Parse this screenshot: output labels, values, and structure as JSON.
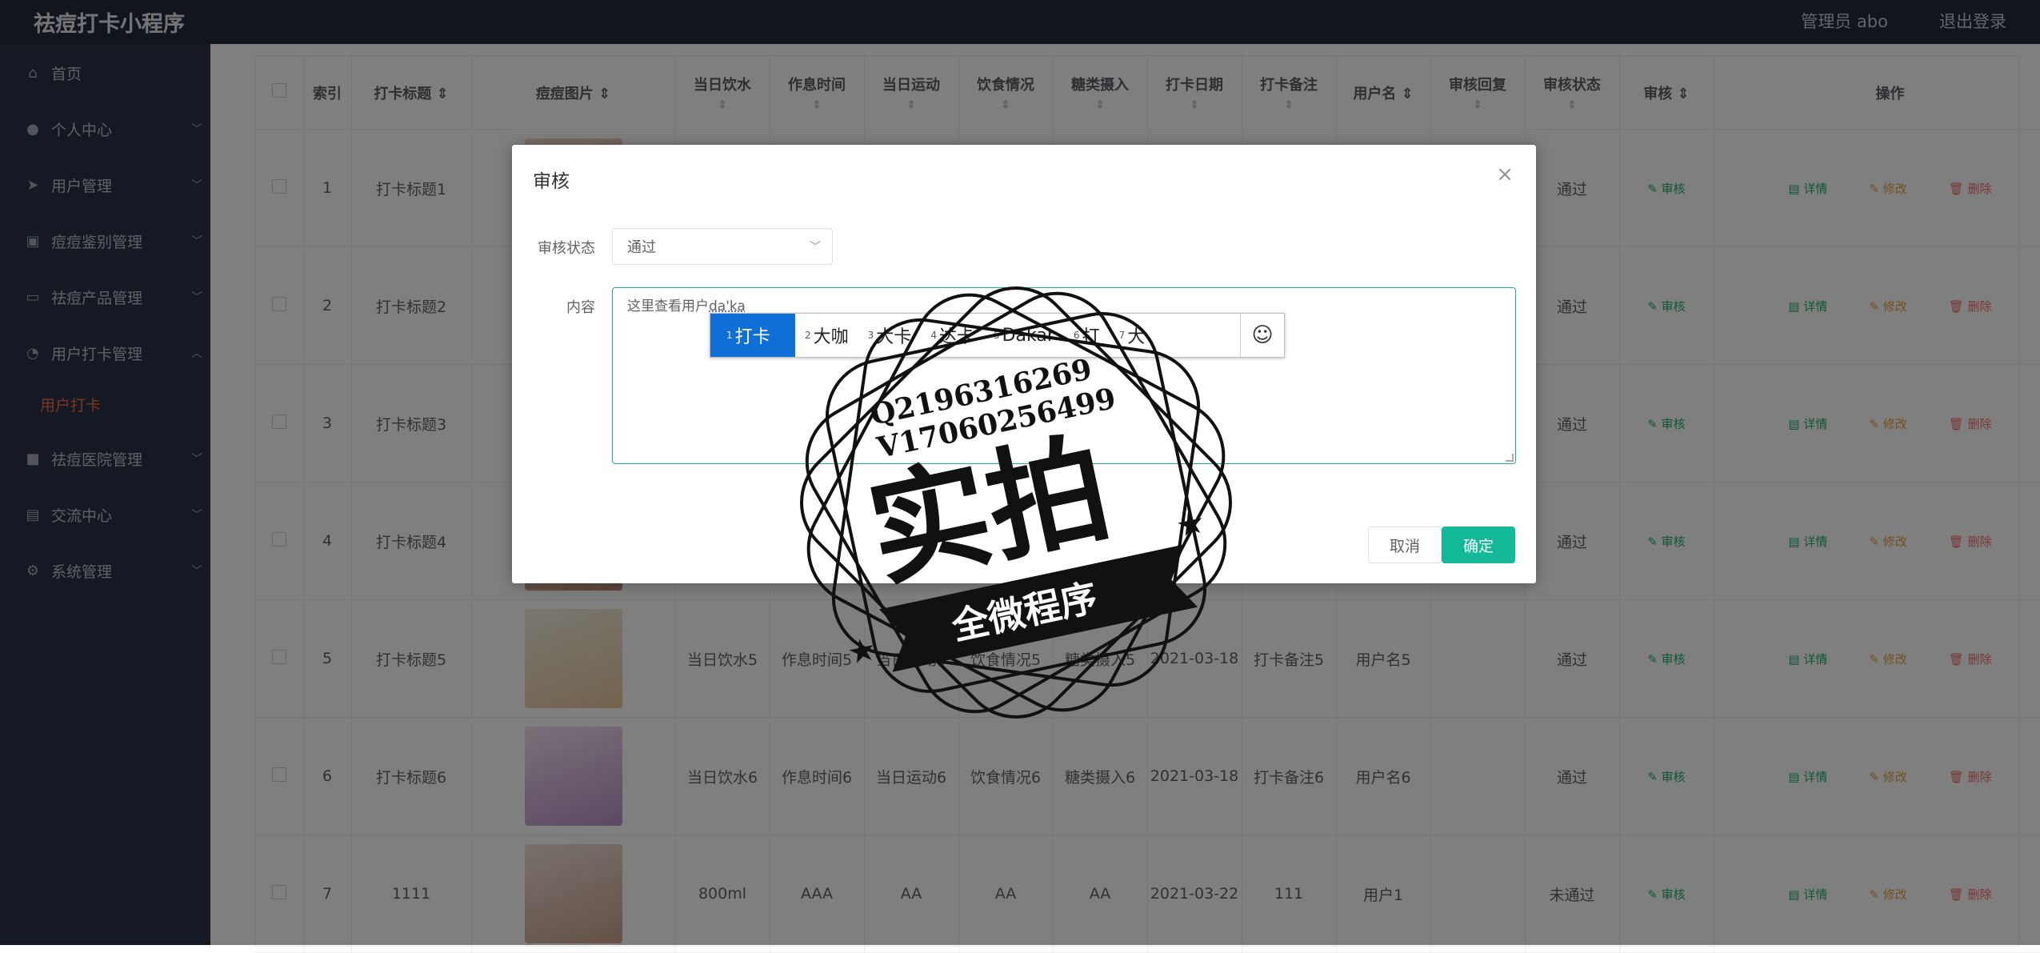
{
  "app": {
    "title": "祛痘打卡小程序",
    "admin": "管理员 abo",
    "logout": "退出登录"
  },
  "sidebar": {
    "items": [
      {
        "label": "首页",
        "icon": "home-icon"
      },
      {
        "label": "个人中心",
        "icon": "user-icon"
      },
      {
        "label": "用户管理",
        "icon": "send-icon"
      },
      {
        "label": "痘痘鉴别管理",
        "icon": "picture-icon"
      },
      {
        "label": "祛痘产品管理",
        "icon": "chat-icon"
      },
      {
        "label": "用户打卡管理",
        "icon": "gauge-icon"
      },
      {
        "label": "用户打卡",
        "icon": ""
      },
      {
        "label": "祛痘医院管理",
        "icon": "briefcase-icon"
      },
      {
        "label": "交流中心",
        "icon": "document-icon"
      },
      {
        "label": "系统管理",
        "icon": "settings-icon"
      }
    ]
  },
  "table": {
    "headers": [
      "索引",
      "打卡标题",
      "痘痘图片",
      "当日饮水",
      "作息时间",
      "当日运动",
      "饮食情况",
      "糖类摄入",
      "打卡日期",
      "打卡备注",
      "用户名",
      "审核回复",
      "审核状态",
      "审核",
      "操作"
    ],
    "rows": [
      {
        "index": "1",
        "title": "打卡标题1",
        "water": "",
        "schedule": "",
        "sport": "",
        "diet": "",
        "sugar": "",
        "date": "",
        "note": "",
        "user": "",
        "reply": "",
        "status": "通过"
      },
      {
        "index": "2",
        "title": "打卡标题2",
        "water": "",
        "schedule": "",
        "sport": "",
        "diet": "",
        "sugar": "",
        "date": "",
        "note": "",
        "user": "",
        "reply": "",
        "status": "通过"
      },
      {
        "index": "3",
        "title": "打卡标题3",
        "water": "",
        "schedule": "",
        "sport": "",
        "diet": "",
        "sugar": "",
        "date": "",
        "note": "",
        "user": "",
        "reply": "",
        "status": "通过"
      },
      {
        "index": "4",
        "title": "打卡标题4",
        "water": "",
        "schedule": "",
        "sport": "",
        "diet": "",
        "sugar": "",
        "date": "",
        "note": "",
        "user": "",
        "reply": "",
        "status": "通过"
      },
      {
        "index": "5",
        "title": "打卡标题5",
        "water": "当日饮水5",
        "schedule": "作息时间5",
        "sport": "当日运动5",
        "diet": "饮食情况5",
        "sugar": "糖类摄入5",
        "date": "2021-03-18",
        "note": "打卡备注5",
        "user": "用户名5",
        "reply": "",
        "status": "通过"
      },
      {
        "index": "6",
        "title": "打卡标题6",
        "water": "当日饮水6",
        "schedule": "作息时间6",
        "sport": "当日运动6",
        "diet": "饮食情况6",
        "sugar": "糖类摄入6",
        "date": "2021-03-18",
        "note": "打卡备注6",
        "user": "用户名6",
        "reply": "",
        "status": "通过"
      },
      {
        "index": "7",
        "title": "1111",
        "water": "800ml",
        "schedule": "AAA",
        "sport": "AA",
        "diet": "AA",
        "sugar": "AA",
        "date": "2021-03-22",
        "note": "111",
        "user": "用户1",
        "reply": "",
        "status": "未通过"
      }
    ],
    "actions": {
      "audit": "审核",
      "detail": "详情",
      "edit": "修改",
      "delete": "删除"
    }
  },
  "dialog": {
    "title": "审核",
    "status_label": "审核状态",
    "status_value": "通过",
    "content_label": "内容",
    "content_text": "这里查看用户",
    "composition": "da'ka",
    "cancel": "取消",
    "confirm": "确定"
  },
  "ime": {
    "candidates": [
      {
        "idx": "1",
        "text": "打卡"
      },
      {
        "idx": "2",
        "text": "大咖"
      },
      {
        "idx": "3",
        "text": "大卡"
      },
      {
        "idx": "4",
        "text": "达卡"
      },
      {
        "idx": "5",
        "text": "Dakar"
      },
      {
        "idx": "6",
        "text": "打"
      },
      {
        "idx": "7",
        "text": "大"
      }
    ],
    "emoji": "☺"
  },
  "watermark": {
    "line1": "Q2196316269",
    "line2": "V17060256499",
    "big": "实拍",
    "banner": "全微程序"
  },
  "colors": {
    "accent": "#14b99a",
    "sidebar_bg": "#2b3248",
    "topbar_bg": "#222a3d",
    "active_menu": "#f56c3a",
    "ime_selected": "#0f6fd6"
  }
}
